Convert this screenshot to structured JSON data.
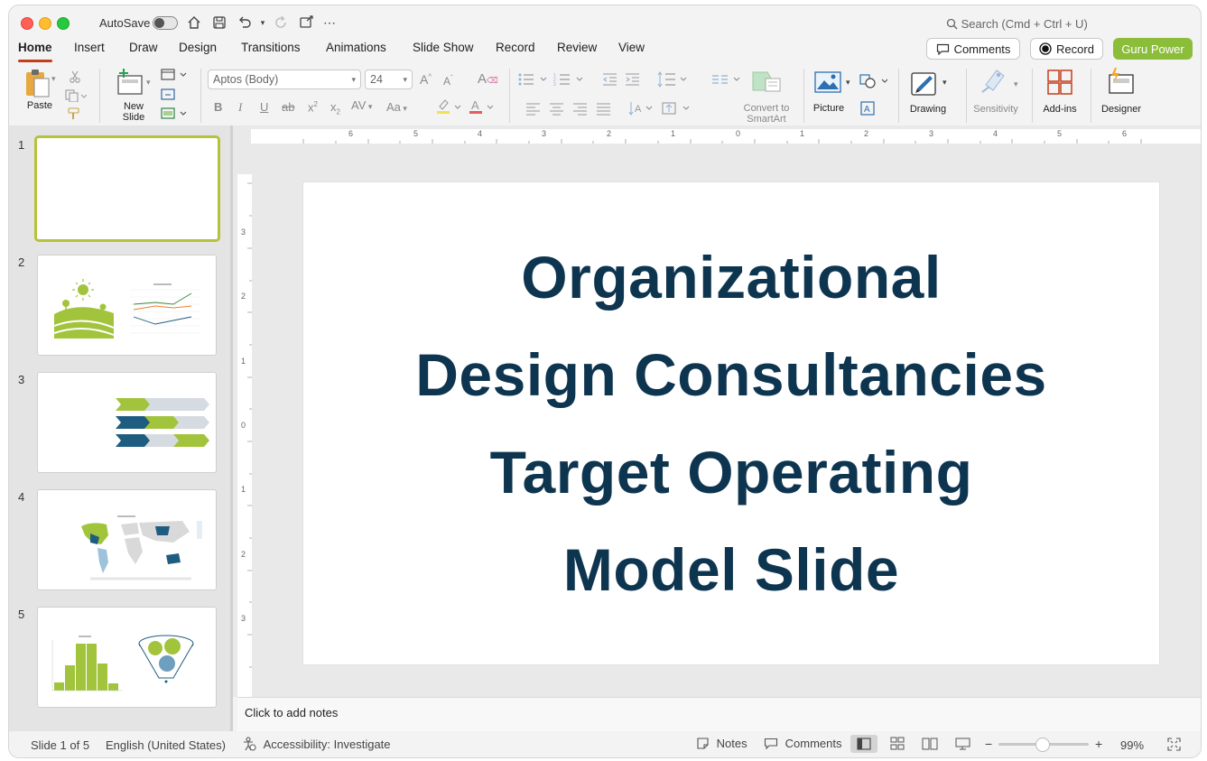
{
  "titlebar": {
    "autosave_label": "AutoSave",
    "search_placeholder": "Search (Cmd + Ctrl + U)"
  },
  "tabs": [
    {
      "label": "Home"
    },
    {
      "label": "Insert"
    },
    {
      "label": "Draw"
    },
    {
      "label": "Design"
    },
    {
      "label": "Transitions"
    },
    {
      "label": "Animations"
    },
    {
      "label": "Slide Show"
    },
    {
      "label": "Record"
    },
    {
      "label": "Review"
    },
    {
      "label": "View"
    }
  ],
  "actions": {
    "comments": "Comments",
    "record": "Record",
    "guru": "Guru Power"
  },
  "ribbon": {
    "paste": "Paste",
    "new_slide_1": "New",
    "new_slide_2": "Slide",
    "font_name": "Aptos (Body)",
    "font_size": "24",
    "convert_1": "Convert to",
    "convert_2": "SmartArt",
    "picture": "Picture",
    "drawing": "Drawing",
    "sensitivity": "Sensitivity",
    "addins": "Add-ins",
    "designer": "Designer"
  },
  "thumbnails": [
    {
      "number": "1"
    },
    {
      "number": "2"
    },
    {
      "number": "3"
    },
    {
      "number": "4"
    },
    {
      "number": "5"
    }
  ],
  "slide": {
    "title_lines": [
      "Organizational",
      "Design Consultancies",
      "Target Operating",
      "Model Slide"
    ]
  },
  "ruler": {
    "h_labels": [
      "6",
      "5",
      "4",
      "3",
      "2",
      "1",
      "0",
      "1",
      "2",
      "3",
      "4",
      "5",
      "6"
    ],
    "v_labels": [
      "3",
      "2",
      "1",
      "0",
      "1",
      "2",
      "3"
    ]
  },
  "notes_placeholder": "Click to add notes",
  "status": {
    "slide": "Slide 1 of 5",
    "language": "English (United States)",
    "accessibility": "Accessibility: Investigate",
    "notes": "Notes",
    "comments": "Comments",
    "zoom": "99%"
  },
  "colors": {
    "accent_tab": "#c43e1c",
    "guru": "#8bbd3a",
    "title_text": "#0e3550",
    "thumb_green": "#a2c43c",
    "thumb_blue": "#1f5d80"
  }
}
